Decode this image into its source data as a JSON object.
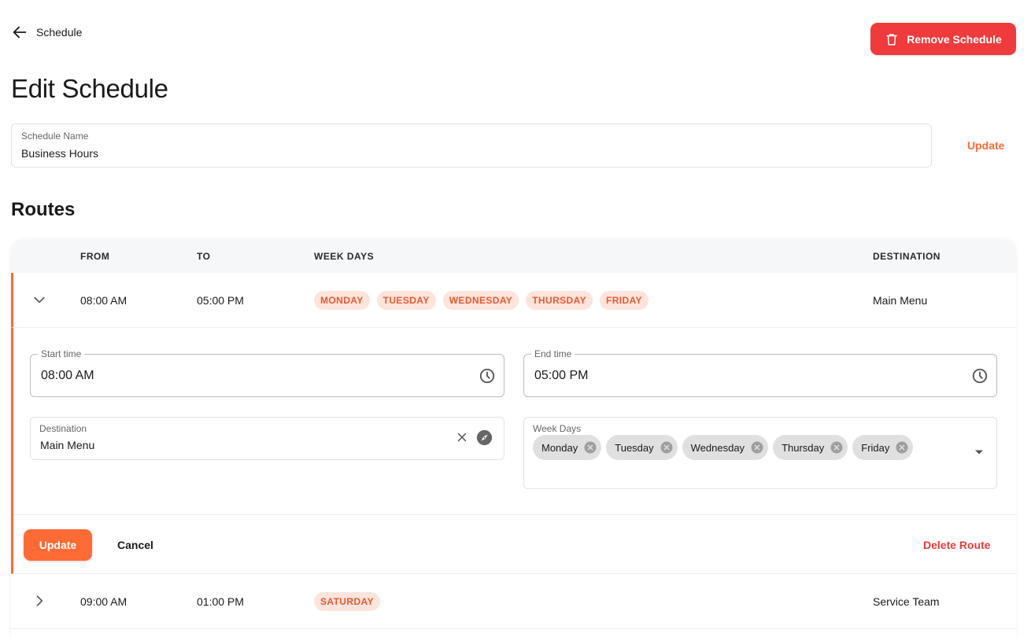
{
  "header": {
    "back_label": "Schedule",
    "remove_label": "Remove Schedule",
    "title": "Edit Schedule"
  },
  "schedule_name": {
    "label": "Schedule Name",
    "value": "Business Hours",
    "update_label": "Update"
  },
  "routes": {
    "title": "Routes",
    "columns": {
      "from": "FROM",
      "to": "TO",
      "week_days": "WEEK DAYS",
      "destination": "DESTINATION"
    },
    "rows": [
      {
        "from": "08:00 AM",
        "to": "05:00 PM",
        "days": [
          "MONDAY",
          "TUESDAY",
          "WEDNESDAY",
          "THURSDAY",
          "FRIDAY"
        ],
        "destination": "Main Menu",
        "expanded": true
      },
      {
        "from": "09:00 AM",
        "to": "01:00 PM",
        "days": [
          "SATURDAY"
        ],
        "destination": "Service Team",
        "expanded": false
      }
    ]
  },
  "editor": {
    "start_time": {
      "label": "Start time",
      "value": "08:00 AM"
    },
    "end_time": {
      "label": "End time",
      "value": "05:00 PM"
    },
    "destination": {
      "label": "Destination",
      "value": "Main Menu"
    },
    "week_days": {
      "label": "Week Days",
      "selected": [
        "Monday",
        "Tuesday",
        "Wednesday",
        "Thursday",
        "Friday"
      ]
    },
    "update_label": "Update",
    "cancel_label": "Cancel",
    "delete_label": "Delete Route"
  },
  "colors": {
    "accent": "#ff6b35",
    "danger": "#ef3b3b",
    "chip_bg": "#fde4dc",
    "chip_text": "#e85a30"
  },
  "icons": {
    "back": "arrow-left-icon",
    "remove": "trash-icon",
    "collapse": "chevron-down-icon",
    "expand": "chevron-right-icon",
    "time": "clock-icon",
    "clear": "close-icon",
    "destination": "compass-icon",
    "remove_tag": "cancel-circle-icon",
    "dropdown": "caret-down-icon"
  }
}
